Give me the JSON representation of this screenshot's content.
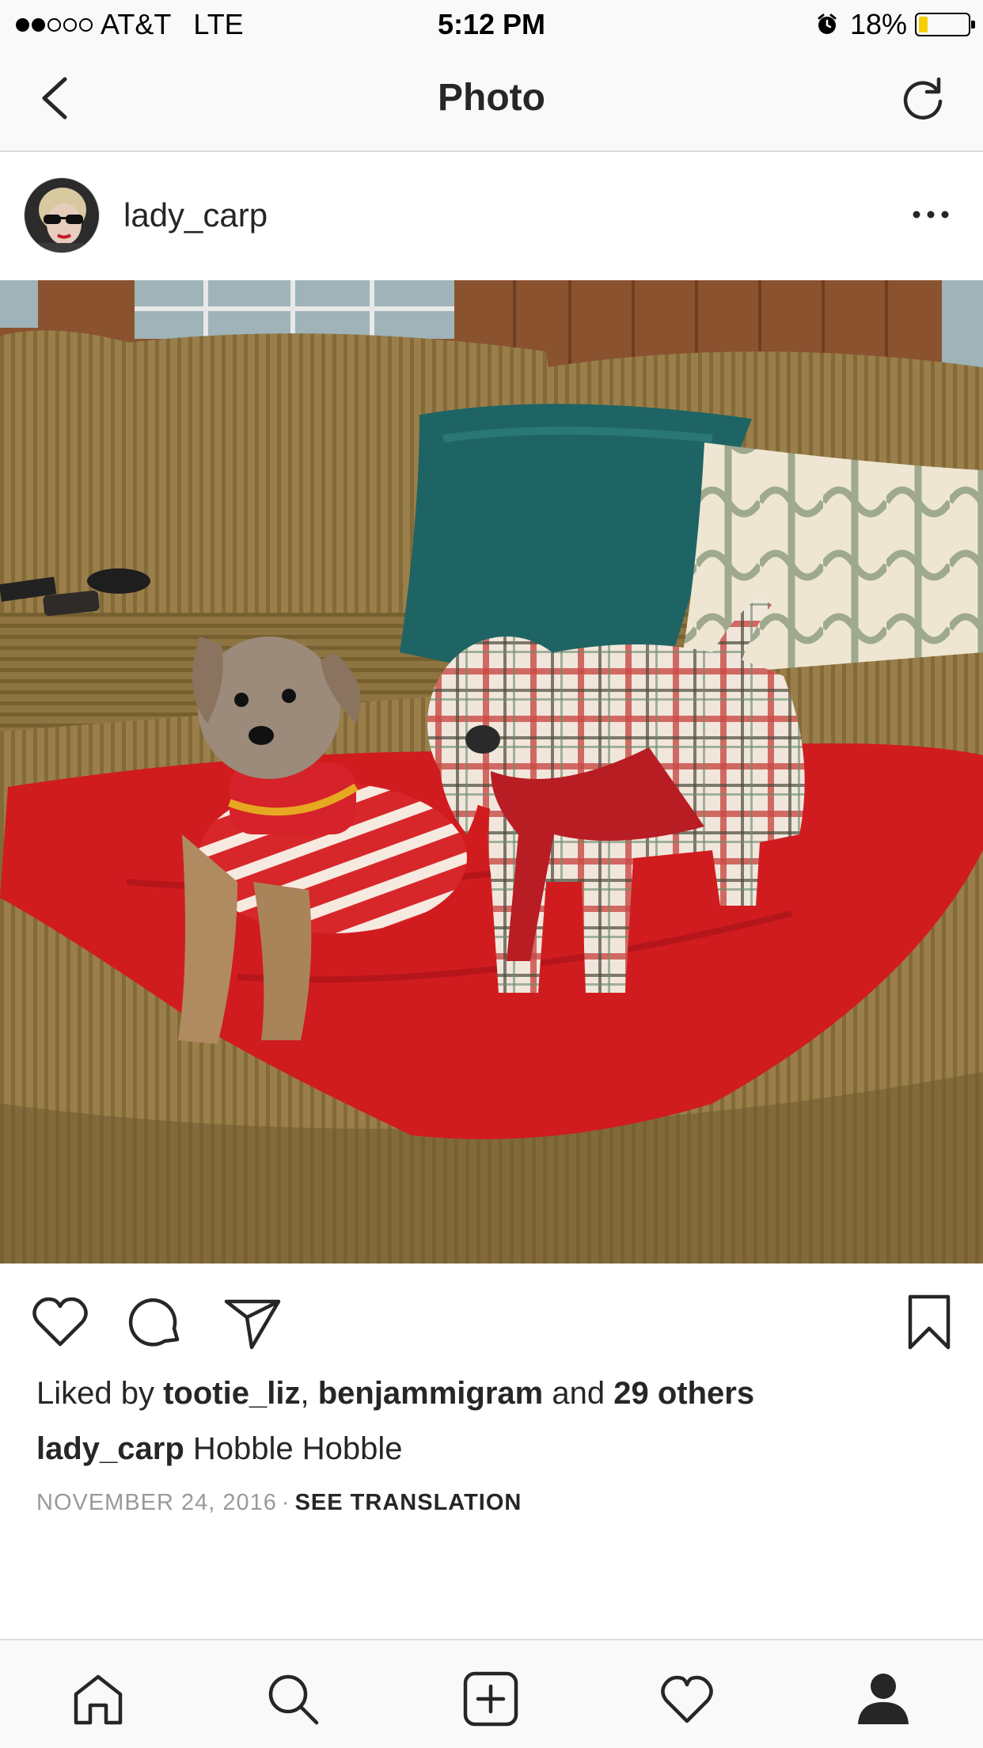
{
  "status_bar": {
    "carrier": "AT&T",
    "network": "LTE",
    "time": "5:12 PM",
    "battery_text": "18%",
    "battery_level": 0.18,
    "signal_bars_on": 2,
    "signal_bars_total": 5
  },
  "nav": {
    "title": "Photo",
    "back_icon": "chevron-left-icon",
    "refresh_icon": "refresh-icon"
  },
  "post": {
    "username": "lady_carp",
    "more_icon": "ellipsis-icon",
    "likes_prefix": "Liked by",
    "liker_1": "tootie_liz",
    "liker_sep": ",",
    "liker_2": "benjammigram",
    "likes_and": "and",
    "likes_others": "29 others",
    "caption_user": "lady_carp",
    "caption_text": "Hobble Hobble",
    "date": "NOVEMBER 24, 2016",
    "meta_sep": "·",
    "see_translation": "SEE TRANSLATION"
  },
  "actions": {
    "icons": [
      "heart-icon",
      "comment-icon",
      "send-icon",
      "bookmark-icon"
    ]
  },
  "tab_bar": {
    "icons": [
      "home-icon",
      "search-icon",
      "add-icon",
      "activity-heart-icon",
      "profile-icon"
    ],
    "active": "profile-icon"
  },
  "colors": {
    "text": "#262626",
    "muted": "#999999",
    "bar_bg": "#f9f9f9",
    "battery": "#f7ce00"
  }
}
